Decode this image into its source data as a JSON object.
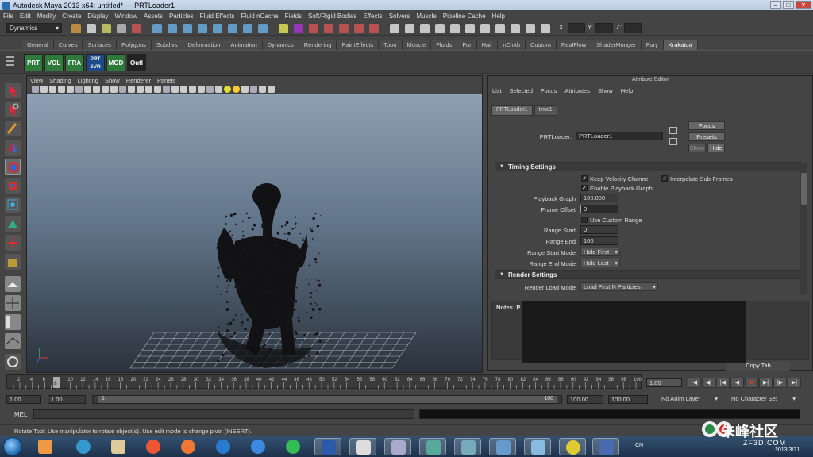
{
  "window": {
    "title": "Autodesk Maya 2013 x64: untitled*   ---   PRTLoader1"
  },
  "menubar": [
    "File",
    "Edit",
    "Modify",
    "Create",
    "Display",
    "Window",
    "Assets",
    "Particles",
    "Fluid Effects",
    "Fluid nCache",
    "Fields",
    "Soft/Rigid Bodies",
    "Effects",
    "Solvers",
    "Muscle",
    "Pipeline Cache",
    "Help"
  ],
  "statusline": {
    "mode": "Dynamics",
    "x_label": "X:",
    "y_label": "Y:",
    "z_label": "Z:"
  },
  "shelf": {
    "tabs": [
      "General",
      "Curves",
      "Surfaces",
      "Polygons",
      "Subdivs",
      "Deformation",
      "Animation",
      "Dynamics",
      "Rendering",
      "PaintEffects",
      "Toon",
      "Muscle",
      "Fluids",
      "Fur",
      "Hair",
      "nCloth",
      "Custom",
      "RealFlow",
      "ShaderMonger",
      "Fury",
      "Krakatoa"
    ],
    "active_tab": "Krakatoa",
    "buttons": [
      "PRT",
      "VOL",
      "FRA",
      "PRT SVR",
      "MOD",
      "Outl"
    ],
    "button_colors": [
      "#2e7a3a",
      "#2e7a3a",
      "#2e7a3a",
      "#1d4a8a",
      "#2e7a3a",
      "#222222"
    ]
  },
  "viewport": {
    "menu": [
      "View",
      "Shading",
      "Lighting",
      "Show",
      "Renderer",
      "Panels"
    ]
  },
  "attribute_editor": {
    "title": "Attribute Editor",
    "menu": [
      "List",
      "Selected",
      "Focus",
      "Attributes",
      "Show",
      "Help"
    ],
    "tabs": [
      "PRTLoader1",
      "time1"
    ],
    "node_label": "PRTLoader:",
    "node_value": "PRTLoader1",
    "focus": "Focus",
    "presets": "Presets",
    "show": "Show",
    "hide": "Hide",
    "timing_section": "Timing Settings",
    "keep_velocity": "Keep Velocity Channel",
    "interpolate": "Interpolate Sub-Frames",
    "enable_playback": "Enable Playback Graph",
    "playback_graph_label": "Playback Graph",
    "playback_graph_value": "100.000",
    "frame_offset_label": "Frame Offset",
    "frame_offset_value": "0",
    "use_custom_range": "Use Custom Range",
    "range_start_label": "Range Start",
    "range_start_value": "0",
    "range_end_label": "Range End",
    "range_end_value": "100",
    "range_start_mode_label": "Range Start Mode",
    "range_start_mode_value": "Hold First",
    "range_end_mode_label": "Range End Mode",
    "range_end_mode_value": "Hold Last",
    "render_section": "Render Settings",
    "render_load_mode_label": "Render Load Mode",
    "render_load_mode_value": "Load First N Particles",
    "notes_label": "Notes: P",
    "copy_tab": "Copy Tab"
  },
  "timeslider": {
    "ticks": [
      "2",
      "4",
      "6",
      "8",
      "10",
      "12",
      "14",
      "16",
      "18",
      "20",
      "22",
      "24",
      "26",
      "28",
      "30",
      "32",
      "34",
      "36",
      "38",
      "40",
      "42",
      "44",
      "46",
      "48",
      "50",
      "52",
      "54",
      "56",
      "58",
      "60",
      "62",
      "64",
      "66",
      "68",
      "70",
      "72",
      "74",
      "76",
      "78",
      "80",
      "82",
      "84",
      "86",
      "88",
      "90",
      "92",
      "94",
      "96",
      "98",
      "100"
    ],
    "current_frame_marker": "8",
    "current_frame_field": "1.00"
  },
  "rangebar": {
    "start_time": "1.00",
    "playback_start": "1.00",
    "slider_start": "1",
    "slider_end": "100",
    "playback_end": "100.00",
    "end_time": "100.00",
    "anim_layer": "No Anim Layer",
    "char_set": "No Character Set"
  },
  "cmdline": {
    "label": "MEL"
  },
  "helpline": {
    "text": "Rotate Tool: Use manipulator to rotate object(s). Use edit mode to change pivot (INSERT)."
  },
  "taskbar": {
    "tray_lang": "CN",
    "date": "2013/3/31"
  },
  "watermark": {
    "text": "朱峰社区",
    "sub": "ZF3D.COM"
  }
}
